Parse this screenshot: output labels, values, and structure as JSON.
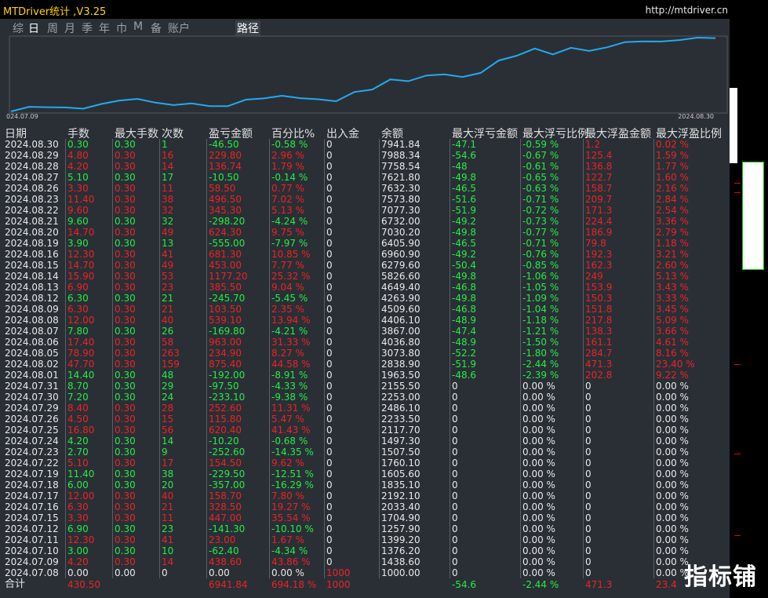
{
  "window": {
    "title": "MTDriver统计 ,V3.25",
    "url": "http://mtdriver.cn"
  },
  "tabs": [
    "综",
    "日",
    "周",
    "月",
    "季",
    "年",
    "巾",
    "M",
    "备",
    "账户"
  ],
  "active_tab": "日",
  "path_tab": "路径",
  "chart": {
    "start_label": "024.07.09",
    "end_label": "2024.08.30",
    "line_color": "#22aaee",
    "balance_series": [
      1000,
      1438.6,
      1399.2,
      1376.2,
      1257.9,
      1704.9,
      2033.4,
      2192.1,
      1835.1,
      1605.6,
      1760.1,
      1507.5,
      1497.3,
      2117.7,
      2233.5,
      2486.1,
      2253.0,
      2155.5,
      1963.5,
      2838.9,
      3073.8,
      4036.8,
      3867.0,
      4406.1,
      4509.6,
      4263.9,
      4649.4,
      5826.6,
      6279.6,
      6960.9,
      6405.9,
      7030.2,
      6732.0,
      7077.3,
      7573.8,
      7632.3,
      7621.8,
      7758.54,
      7988.34,
      7941.84
    ]
  },
  "headers": [
    "日期",
    "手数",
    "最大手数",
    "次数",
    "盈亏金额",
    "百分比%",
    "出入金",
    "余额",
    "最大浮亏金额",
    "最大浮亏比例",
    "最大浮盈金额",
    "最大浮盈比例"
  ],
  "rows": [
    [
      "2024.08.30",
      "0.30",
      "0.30",
      "1",
      "-46.50",
      "-0.58 %",
      "0",
      "7941.84",
      "-47.1",
      "-0.59 %",
      "1.2",
      "0.02 %"
    ],
    [
      "2024.08.29",
      "4.80",
      "0.30",
      "16",
      "229.80",
      "2.96 %",
      "0",
      "7988.34",
      "-54.6",
      "-0.67 %",
      "125.4",
      "1.59 %"
    ],
    [
      "2024.08.28",
      "4.20",
      "0.30",
      "14",
      "136.74",
      "1.79 %",
      "0",
      "7758.54",
      "-48",
      "-0.61 %",
      "136.8",
      "1.77 %"
    ],
    [
      "2024.08.27",
      "5.10",
      "0.30",
      "17",
      "-10.50",
      "-0.14 %",
      "0",
      "7621.80",
      "-49.8",
      "-0.65 %",
      "122.7",
      "1.60 %"
    ],
    [
      "2024.08.26",
      "3.30",
      "0.30",
      "11",
      "58.50",
      "0.77 %",
      "0",
      "7632.30",
      "-46.5",
      "-0.63 %",
      "158.7",
      "2.16 %"
    ],
    [
      "2024.08.23",
      "11.40",
      "0.30",
      "38",
      "496.50",
      "7.02 %",
      "0",
      "7573.80",
      "-51.6",
      "-0.71 %",
      "209.7",
      "2.84 %"
    ],
    [
      "2024.08.22",
      "9.60",
      "0.30",
      "32",
      "345.30",
      "5.13 %",
      "0",
      "7077.30",
      "-51.9",
      "-0.72 %",
      "171.3",
      "2.54 %"
    ],
    [
      "2024.08.21",
      "9.60",
      "0.30",
      "32",
      "-298.20",
      "-4.24 %",
      "0",
      "6732.00",
      "-49.2",
      "-0.73 %",
      "224.4",
      "3.36 %"
    ],
    [
      "2024.08.20",
      "14.70",
      "0.30",
      "49",
      "624.30",
      "9.75 %",
      "0",
      "7030.20",
      "-49.8",
      "-0.77 %",
      "186.9",
      "2.79 %"
    ],
    [
      "2024.08.19",
      "3.90",
      "0.30",
      "13",
      "-555.00",
      "-7.97 %",
      "0",
      "6405.90",
      "-46.5",
      "-0.71 %",
      "79.8",
      "1.18 %"
    ],
    [
      "2024.08.16",
      "12.30",
      "0.30",
      "41",
      "681.30",
      "10.85 %",
      "0",
      "6960.90",
      "-49.2",
      "-0.76 %",
      "192.3",
      "3.21 %"
    ],
    [
      "2024.08.15",
      "14.70",
      "0.30",
      "49",
      "453.00",
      "7.77 %",
      "0",
      "6279.60",
      "-50.4",
      "-0.85 %",
      "162.3",
      "2.60 %"
    ],
    [
      "2024.08.14",
      "15.90",
      "0.30",
      "53",
      "1177.20",
      "25.32 %",
      "0",
      "5826.60",
      "-49.8",
      "-1.06 %",
      "249",
      "5.13 %"
    ],
    [
      "2024.08.13",
      "6.90",
      "0.30",
      "23",
      "385.50",
      "9.04 %",
      "0",
      "4649.40",
      "-46.8",
      "-1.05 %",
      "153.9",
      "3.43 %"
    ],
    [
      "2024.08.12",
      "6.30",
      "0.30",
      "21",
      "-245.70",
      "-5.45 %",
      "0",
      "4263.90",
      "-49.8",
      "-1.09 %",
      "150.3",
      "3.33 %"
    ],
    [
      "2024.08.09",
      "6.30",
      "0.30",
      "21",
      "103.50",
      "2.35 %",
      "0",
      "4509.60",
      "-46.8",
      "-1.04 %",
      "151.8",
      "3.45 %"
    ],
    [
      "2024.08.08",
      "12.00",
      "0.30",
      "40",
      "539.10",
      "13.94 %",
      "0",
      "4406.10",
      "-48.9",
      "-1.18 %",
      "217.8",
      "5.09 %"
    ],
    [
      "2024.08.07",
      "7.80",
      "0.30",
      "26",
      "-169.80",
      "-4.21 %",
      "0",
      "3867.00",
      "-47.4",
      "-1.21 %",
      "138.3",
      "3.66 %"
    ],
    [
      "2024.08.06",
      "17.40",
      "0.30",
      "58",
      "963.00",
      "31.33 %",
      "0",
      "4036.80",
      "-48.9",
      "-1.50 %",
      "161.1",
      "4.61 %"
    ],
    [
      "2024.08.05",
      "78.90",
      "0.30",
      "263",
      "234.90",
      "8.27 %",
      "0",
      "3073.80",
      "-52.2",
      "-1.80 %",
      "284.7",
      "8.16 %"
    ],
    [
      "2024.08.02",
      "47.70",
      "0.30",
      "159",
      "875.40",
      "44.58 %",
      "0",
      "2838.90",
      "-51.9",
      "-2.44 %",
      "471.3",
      "23.40 %"
    ],
    [
      "2024.08.01",
      "14.40",
      "0.30",
      "48",
      "-192.00",
      "-8.91 %",
      "0",
      "1963.50",
      "-48.6",
      "-2.39 %",
      "202.8",
      "9.22 %"
    ],
    [
      "2024.07.31",
      "8.70",
      "0.30",
      "29",
      "-97.50",
      "-4.33 %",
      "0",
      "2155.50",
      "0",
      "0.00 %",
      "0",
      "0.00 %"
    ],
    [
      "2024.07.30",
      "7.20",
      "0.30",
      "24",
      "-233.10",
      "-9.38 %",
      "0",
      "2253.00",
      "0",
      "0.00 %",
      "0",
      "0.00 %"
    ],
    [
      "2024.07.29",
      "8.40",
      "0.30",
      "28",
      "252.60",
      "11.31 %",
      "0",
      "2486.10",
      "0",
      "0.00 %",
      "0",
      "0.00 %"
    ],
    [
      "2024.07.26",
      "4.50",
      "0.30",
      "15",
      "115.80",
      "5.47 %",
      "0",
      "2233.50",
      "0",
      "0.00 %",
      "0",
      "0.00 %"
    ],
    [
      "2024.07.25",
      "16.80",
      "0.30",
      "56",
      "620.40",
      "41.43 %",
      "0",
      "2117.70",
      "0",
      "0.00 %",
      "0",
      "0.00 %"
    ],
    [
      "2024.07.24",
      "4.20",
      "0.30",
      "14",
      "-10.20",
      "-0.68 %",
      "0",
      "1497.30",
      "0",
      "0.00 %",
      "0",
      "0.00 %"
    ],
    [
      "2024.07.23",
      "2.70",
      "0.30",
      "9",
      "-252.60",
      "-14.35 %",
      "0",
      "1507.50",
      "0",
      "0.00 %",
      "0",
      "0.00 %"
    ],
    [
      "2024.07.22",
      "5.10",
      "0.30",
      "17",
      "154.50",
      "9.62 %",
      "0",
      "1760.10",
      "0",
      "0.00 %",
      "0",
      "0.00 %"
    ],
    [
      "2024.07.19",
      "11.40",
      "0.30",
      "38",
      "-229.50",
      "-12.51 %",
      "0",
      "1605.60",
      "0",
      "0.00 %",
      "0",
      "0.00 %"
    ],
    [
      "2024.07.18",
      "6.00",
      "0.30",
      "20",
      "-357.00",
      "-16.29 %",
      "0",
      "1835.10",
      "0",
      "0.00 %",
      "0",
      "0.00 %"
    ],
    [
      "2024.07.17",
      "12.00",
      "0.30",
      "40",
      "158.70",
      "7.80 %",
      "0",
      "2192.10",
      "0",
      "0.00 %",
      "0",
      "0.00 %"
    ],
    [
      "2024.07.16",
      "6.30",
      "0.30",
      "21",
      "328.50",
      "19.27 %",
      "0",
      "2033.40",
      "0",
      "0.00 %",
      "0",
      "0.00 %"
    ],
    [
      "2024.07.15",
      "3.30",
      "0.30",
      "11",
      "447.00",
      "35.54 %",
      "0",
      "1704.90",
      "0",
      "0.00 %",
      "0",
      "0.00 %"
    ],
    [
      "2024.07.12",
      "6.90",
      "0.30",
      "23",
      "-141.30",
      "-10.10 %",
      "0",
      "1257.90",
      "0",
      "0.00 %",
      "0",
      "0.00 %"
    ],
    [
      "2024.07.11",
      "12.30",
      "0.30",
      "41",
      "23.00",
      "1.67 %",
      "0",
      "1399.20",
      "0",
      "0.00 %",
      "0",
      "0.00 %"
    ],
    [
      "2024.07.10",
      "3.00",
      "0.30",
      "10",
      "-62.40",
      "-4.34 %",
      "0",
      "1376.20",
      "0",
      "0.00 %",
      "0",
      "0.00 %"
    ],
    [
      "2024.07.09",
      "4.20",
      "0.30",
      "14",
      "438.60",
      "43.86 %",
      "0",
      "1438.60",
      "0",
      "0.00 %",
      "0",
      "0.00 %"
    ],
    [
      "2024.07.08",
      "0.00",
      "0.00",
      "0",
      "0.00",
      "0.00 %",
      "1000",
      "1000.00",
      "0",
      "0.00 %",
      "0",
      "0.00 %"
    ]
  ],
  "total": [
    "合计",
    "430.50",
    "",
    "",
    "6941.84",
    "694.18 %",
    "1000",
    "",
    "-54.6",
    "-2.44 %",
    "471.3",
    "23.4"
  ],
  "watermark": "指标铺",
  "colors": {
    "positive": "#ee2222",
    "negative": "#22ee44",
    "neutral": "#e8e8e8",
    "title": "#ffd400"
  }
}
